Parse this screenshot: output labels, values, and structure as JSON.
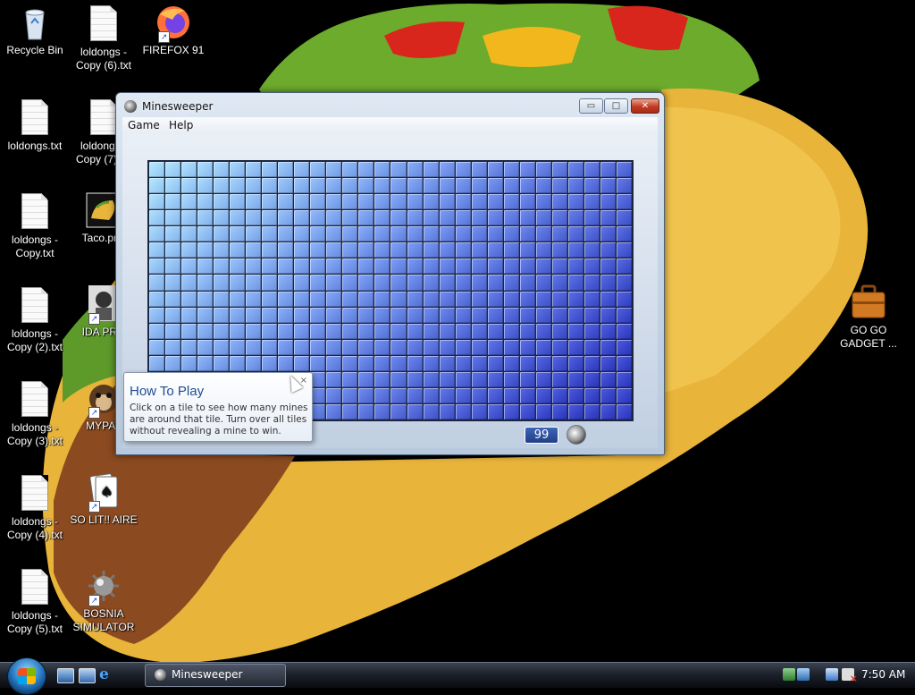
{
  "desktop": {
    "icons": [
      {
        "label": "Recycle Bin",
        "icon": "recycle-bin-icon"
      },
      {
        "label": "loldongs - Copy (6).txt",
        "icon": "text-file-icon"
      },
      {
        "label": "FIREFOX 91",
        "icon": "firefox-icon"
      },
      {
        "label": "loldongs.txt",
        "icon": "text-file-icon"
      },
      {
        "label": "loldongs - Copy (7).txt",
        "icon": "text-file-icon"
      },
      {
        "label": "loldongs - Copy.txt",
        "icon": "text-file-icon"
      },
      {
        "label": "Taco.png",
        "icon": "image-file-icon"
      },
      {
        "label": "loldongs - Copy (2).txt",
        "icon": "text-file-icon"
      },
      {
        "label": "IDA PRO",
        "icon": "ida-pro-icon"
      },
      {
        "label": "loldongs - Copy (3).txt",
        "icon": "text-file-icon"
      },
      {
        "label": "MYPAL",
        "icon": "mypal-icon"
      },
      {
        "label": "loldongs - Copy (4).txt",
        "icon": "text-file-icon"
      },
      {
        "label": "SO LIT!! AIRE",
        "icon": "solitaire-icon"
      },
      {
        "label": "loldongs - Copy (5).txt",
        "icon": "text-file-icon"
      },
      {
        "label": "BOSNIA SIMULATOR",
        "icon": "mine-icon"
      },
      {
        "label": "GO GO GADGET ...",
        "icon": "briefcase-icon"
      }
    ]
  },
  "window": {
    "title": "Minesweeper",
    "buttons": {
      "minimize": "▭",
      "maximize": "□",
      "close": "✕"
    },
    "menu": {
      "game": "Game",
      "help": "Help"
    },
    "board": {
      "columns": 30,
      "rows": 16,
      "tile_color_start": "#8fc4f3",
      "tile_color_end": "#2633b8"
    },
    "mines_remaining": "99"
  },
  "tooltip": {
    "title": "How To Play",
    "body": "Click on a tile to see how many mines are around that tile. Turn over all tiles without revealing a mine to win.",
    "close": "×"
  },
  "taskbar": {
    "start": "start-orb-icon",
    "quicklaunch": [
      "show-desktop-icon",
      "switch-windows-icon",
      "internet-explorer-icon"
    ],
    "tasks": [
      {
        "label": "Minesweeper",
        "icon": "minesweeper-icon"
      }
    ],
    "clock": "7:50 AM"
  }
}
